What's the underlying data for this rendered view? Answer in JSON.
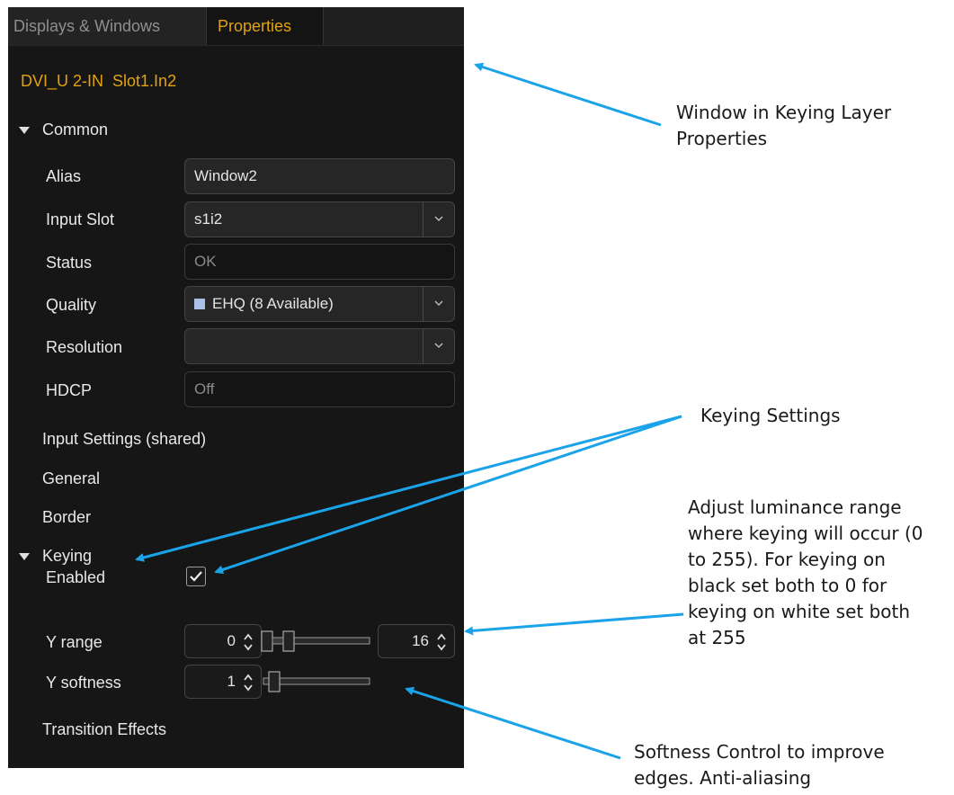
{
  "tabs": {
    "tab1": "Displays & Windows",
    "tab2": "Properties"
  },
  "window_title": "DVI_U 2-IN  Slot1.In2",
  "sections": {
    "common": "Common",
    "input_settings": "Input Settings (shared)",
    "general": "General",
    "border": "Border",
    "keying": "Keying",
    "transition": "Transition Effects"
  },
  "common": {
    "alias_label": "Alias",
    "alias_value": "Window2",
    "input_slot_label": "Input Slot",
    "input_slot_value": "s1i2",
    "status_label": "Status",
    "status_value": "OK",
    "quality_label": "Quality",
    "quality_value": "EHQ (8 Available)",
    "resolution_label": "Resolution",
    "resolution_value": "",
    "hdcp_label": "HDCP",
    "hdcp_value": "Off"
  },
  "keying": {
    "enabled_label": "Enabled",
    "enabled": true,
    "y_range_label": "Y range",
    "y_range_min": "0",
    "y_range_max": "16",
    "y_softness_label": "Y softness",
    "y_softness_value": "1"
  },
  "annotations": {
    "window_line1": "Window in Keying Layer",
    "window_line2": "Properties",
    "keying_settings": "Keying Settings",
    "lum_line1": "Adjust luminance range",
    "lum_line2": "where keying will occur (0",
    "lum_line3": "to 255).  For keying on",
    "lum_line4": "black set both to 0 for",
    "lum_line5": "keying on white set both",
    "lum_line6": "at 255",
    "soft_line1": "Softness Control to improve",
    "soft_line2": "edges. Anti-aliasing"
  },
  "colors": {
    "accent": "#e3a20f",
    "arrow": "#1aa3e8",
    "panel_bg": "#161616"
  }
}
